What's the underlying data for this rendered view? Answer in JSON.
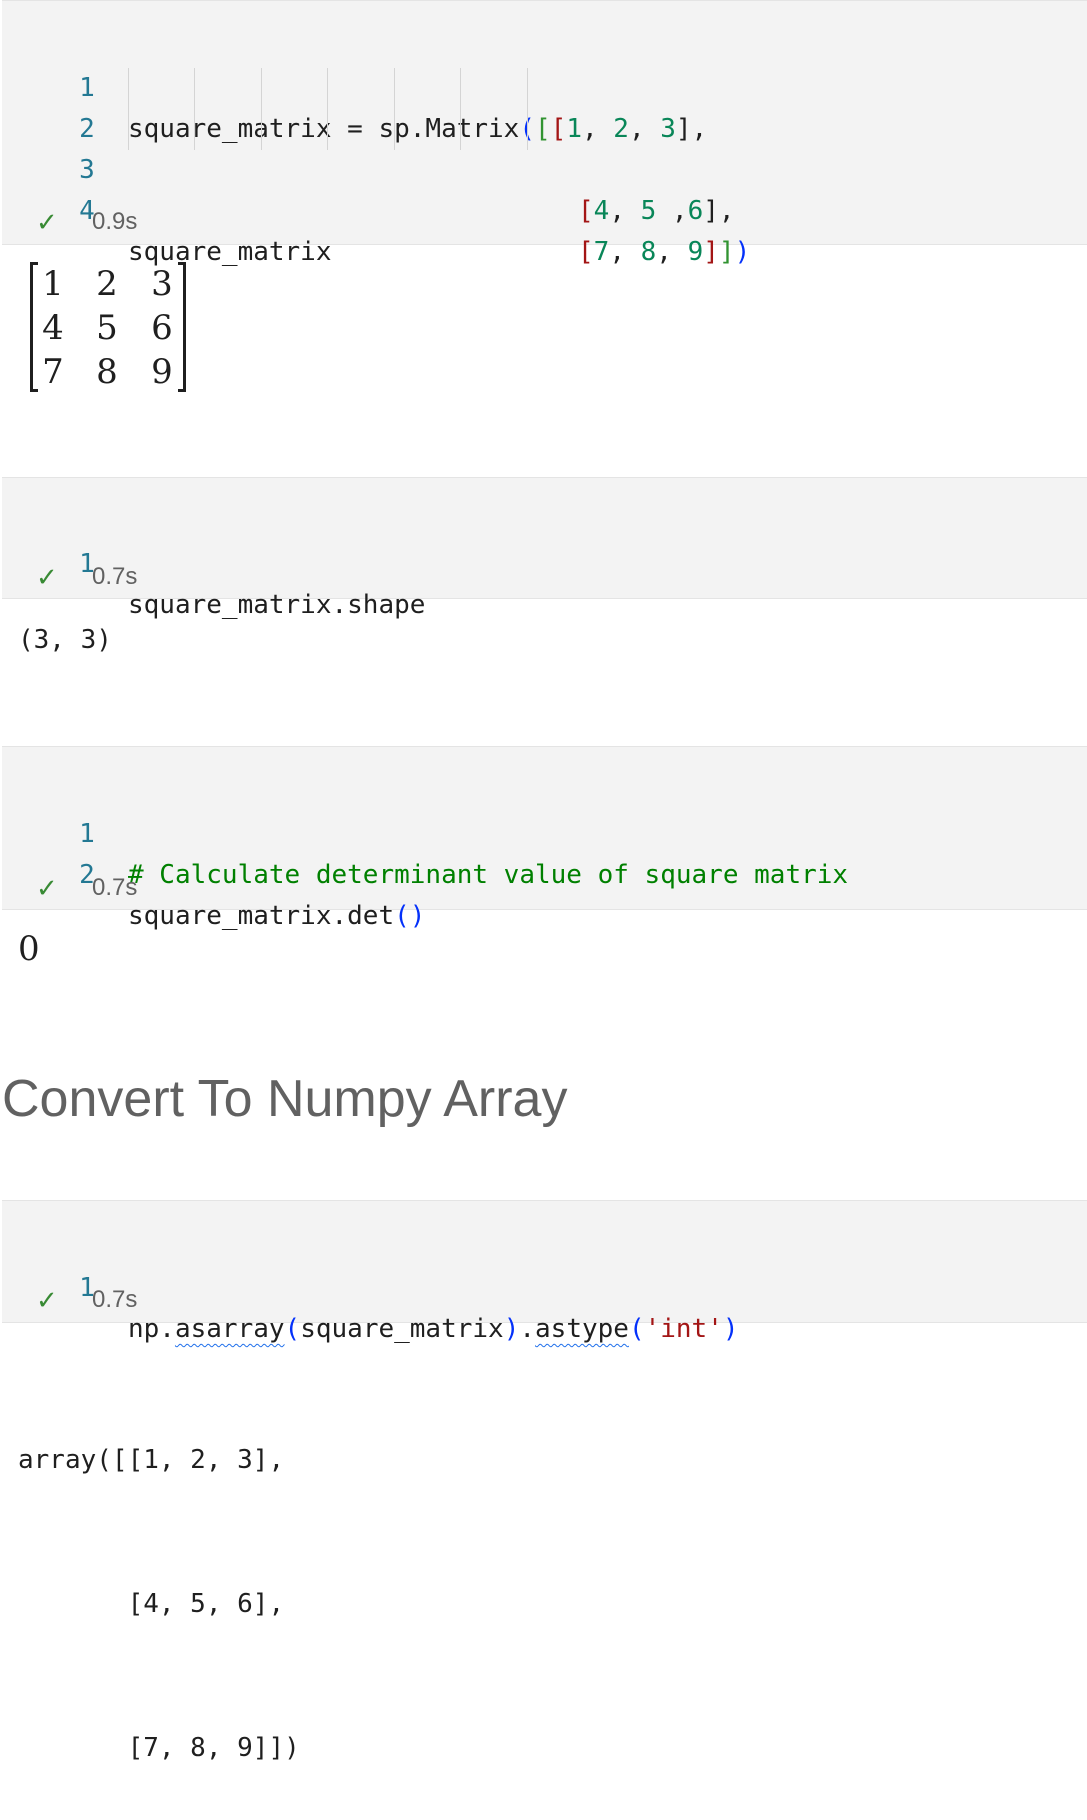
{
  "cells": [
    {
      "lines": [
        {
          "num": "1"
        },
        {
          "num": "2"
        },
        {
          "num": "3"
        },
        {
          "num": "4",
          "text": "square_matrix"
        }
      ],
      "code1": {
        "a": "square_matrix = sp.Matrix",
        "p1": "(",
        "p2": "[",
        "p3": "[",
        "n1": "1",
        "n2": "2",
        "n3": "3",
        "end": "],"
      },
      "code2": {
        "open": "[",
        "n1": "4",
        "n2": "5",
        "n3": "6",
        "end": "],"
      },
      "code3": {
        "open": "[",
        "n1": "7",
        "n2": "8",
        "n3": "9",
        "c1": "]",
        "c2": "]",
        "c3": ")"
      },
      "time": "0.9s"
    },
    {
      "lines": [
        {
          "num": "1",
          "text": "square_matrix.shape"
        }
      ],
      "time": "0.7s"
    },
    {
      "lines": [
        {
          "num": "1",
          "text": "# Calculate determinant value of square matrix"
        },
        {
          "num": "2",
          "text": "square_matrix.det"
        }
      ],
      "paren": "()",
      "time": "0.7s"
    },
    {
      "lines": [
        {
          "num": "1"
        }
      ],
      "code": {
        "a": "np.",
        "f1": "asarray",
        "p1": "(",
        "arg": "square_matrix",
        "p2": ")",
        "dot": ".",
        "f2": "astype",
        "p3": "(",
        "str": "'int'",
        "p4": ")"
      },
      "time": "0.7s"
    }
  ],
  "outputs": {
    "matrix": [
      "1",
      "2",
      "3",
      "4",
      "5",
      "6",
      "7",
      "8",
      "9"
    ],
    "shape": "(3, 3)",
    "det": "0",
    "array": [
      "array([[1, 2, 3],",
      "       [4, 5, 6],",
      "       [7, 8, 9]])"
    ]
  },
  "heading": "Convert To Numpy Array",
  "icons": {
    "check": "check-icon"
  },
  "colors": {
    "line_number": "#237893",
    "check": "#388a34",
    "comment": "#008000",
    "number": "#098658",
    "string": "#a31515",
    "bracket": "#0431fa"
  }
}
